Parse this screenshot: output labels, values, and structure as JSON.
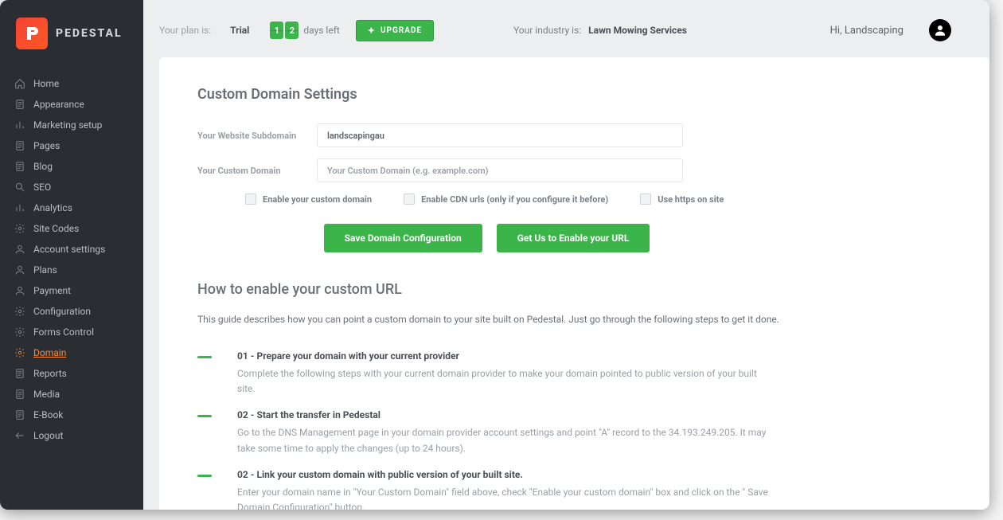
{
  "brand": {
    "name": "PEDESTAL"
  },
  "sidebar": {
    "items": [
      {
        "label": "Home",
        "icon": "home"
      },
      {
        "label": "Appearance",
        "icon": "doc"
      },
      {
        "label": "Marketing setup",
        "icon": "bars"
      },
      {
        "label": "Pages",
        "icon": "doc"
      },
      {
        "label": "Blog",
        "icon": "doc"
      },
      {
        "label": "SEO",
        "icon": "search"
      },
      {
        "label": "Analytics",
        "icon": "bars"
      },
      {
        "label": "Site Codes",
        "icon": "gear"
      },
      {
        "label": "Account settings",
        "icon": "user"
      },
      {
        "label": "Plans",
        "icon": "user"
      },
      {
        "label": "Payment",
        "icon": "user"
      },
      {
        "label": "Configuration",
        "icon": "gear"
      },
      {
        "label": "Forms Control",
        "icon": "gear"
      },
      {
        "label": "Domain",
        "icon": "gear",
        "active": true
      },
      {
        "label": "Reports",
        "icon": "doc"
      },
      {
        "label": "Media",
        "icon": "doc"
      },
      {
        "label": "E-Book",
        "icon": "doc"
      },
      {
        "label": "Logout",
        "icon": "arrow-left"
      }
    ]
  },
  "topbar": {
    "plan_label": "Your plan is:",
    "plan_value": "Trial",
    "days_digits": [
      "1",
      "2"
    ],
    "days_left_label": "days left",
    "upgrade_label": "UPGRADE",
    "industry_label": "Your industry is:",
    "industry_value": "Lawn Mowing Services",
    "greeting": "Hi, Landscaping"
  },
  "domain_settings": {
    "title": "Custom Domain Settings",
    "subdomain_label": "Your Website Subdomain",
    "subdomain_value": "landscapingau",
    "custom_domain_label": "Your Custom Domain",
    "custom_domain_placeholder": "Your Custom Domain (e.g. example.com)",
    "checks": {
      "enable_custom": "Enable your custom domain",
      "enable_cdn": "Enable CDN urls (only if you configure it before)",
      "use_https": "Use https on site"
    },
    "buttons": {
      "save": "Save Domain Configuration",
      "get_us": "Get Us to Enable your URL"
    }
  },
  "howto": {
    "title": "How to enable your custom URL",
    "description": "This guide describes how you can point a custom domain to your site built on Pedestal. Just go through the following steps to get it done.",
    "steps": [
      {
        "title": "01 - Prepare your domain with your current provider",
        "text": "Complete the following steps with your current domain provider to make your domain pointed to public version of your built site."
      },
      {
        "title": "02 - Start the transfer in Pedestal",
        "text": "Go to the DNS Management page in your domain provider account settings and point \"A\" record to the 34.193.249.205. It may take some time to apply the changes (up to 24 hours)."
      },
      {
        "title": "02 - Link your custom domain with public version of your built site.",
        "text": "Enter your domain name in \"Your Custom Domain\" field above, check \"Enable your custom domain\" box and click on the \" Save Domain Configuration\" button."
      }
    ]
  }
}
